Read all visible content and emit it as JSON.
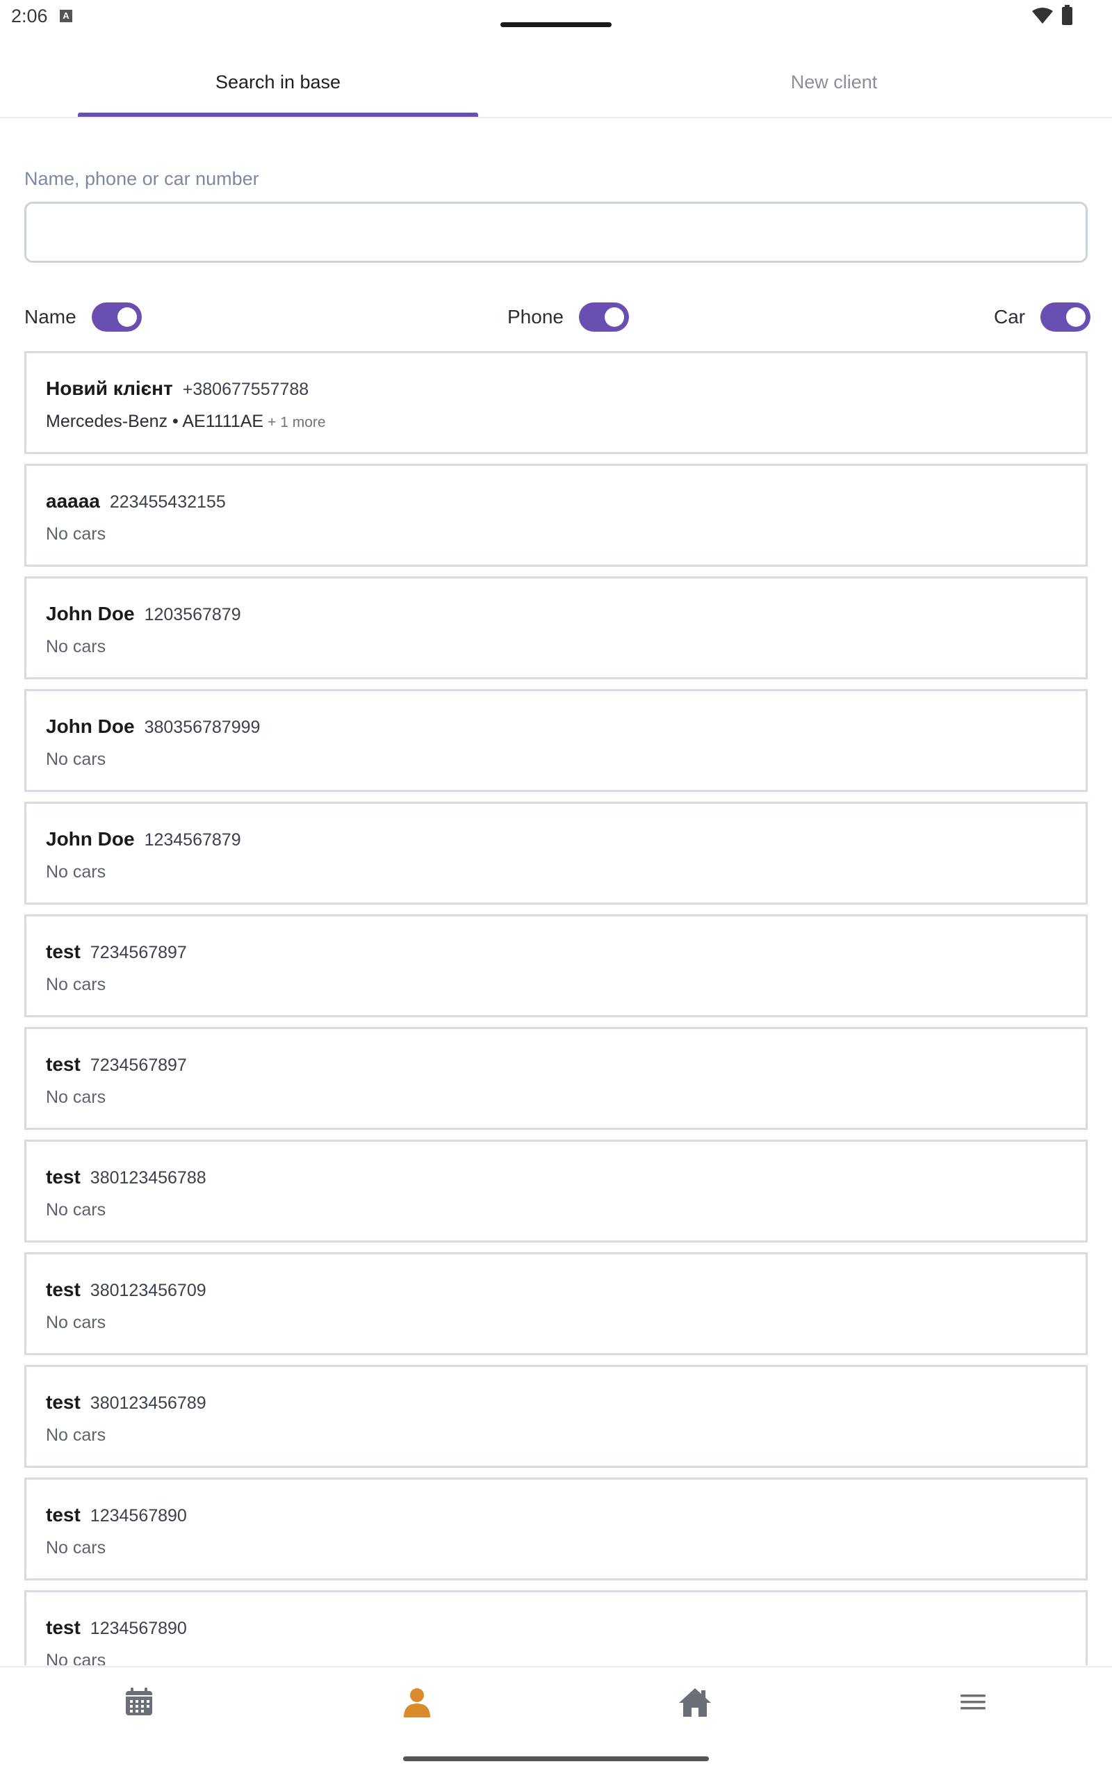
{
  "status_bar": {
    "time": "2:06",
    "notification_icon": "a-icon",
    "wifi_icon": "wifi-icon",
    "battery_icon": "battery-icon"
  },
  "tabs": [
    {
      "label": "Search in base",
      "active": true
    },
    {
      "label": "New client",
      "active": false
    }
  ],
  "colors": {
    "accent": "#6a4fb2",
    "active_nav": "#d98a2b",
    "inactive_nav": "#6b6f78"
  },
  "search": {
    "label": "Name, phone or car number",
    "value": "",
    "placeholder": ""
  },
  "filters": [
    {
      "label": "Name",
      "on": true
    },
    {
      "label": "Phone",
      "on": true
    },
    {
      "label": "Car",
      "on": true
    }
  ],
  "clients": [
    {
      "name": "Новий клієнт",
      "phone": "+380677557788",
      "cars": "Mercedes-Benz • AE1111AE",
      "more": "+ 1 more"
    },
    {
      "name": "aaaaa",
      "phone": "223455432155",
      "cars": "No cars",
      "more": ""
    },
    {
      "name": "John Doe",
      "phone": "1203567879",
      "cars": "No cars",
      "more": ""
    },
    {
      "name": "John Doe",
      "phone": "380356787999",
      "cars": "No cars",
      "more": ""
    },
    {
      "name": "John Doe",
      "phone": "1234567879",
      "cars": "No cars",
      "more": ""
    },
    {
      "name": "test",
      "phone": "7234567897",
      "cars": "No cars",
      "more": ""
    },
    {
      "name": "test",
      "phone": "7234567897",
      "cars": "No cars",
      "more": ""
    },
    {
      "name": "test",
      "phone": "380123456788",
      "cars": "No cars",
      "more": ""
    },
    {
      "name": "test",
      "phone": "380123456709",
      "cars": "No cars",
      "more": ""
    },
    {
      "name": "test",
      "phone": "380123456789",
      "cars": "No cars",
      "more": ""
    },
    {
      "name": "test",
      "phone": "1234567890",
      "cars": "No cars",
      "more": ""
    },
    {
      "name": "test",
      "phone": "1234567890",
      "cars": "No cars",
      "more": ""
    }
  ],
  "bottom_nav": [
    {
      "icon": "calendar-icon",
      "active": false
    },
    {
      "icon": "person-icon",
      "active": true
    },
    {
      "icon": "home-icon",
      "active": false
    },
    {
      "icon": "menu-icon",
      "active": false
    }
  ]
}
